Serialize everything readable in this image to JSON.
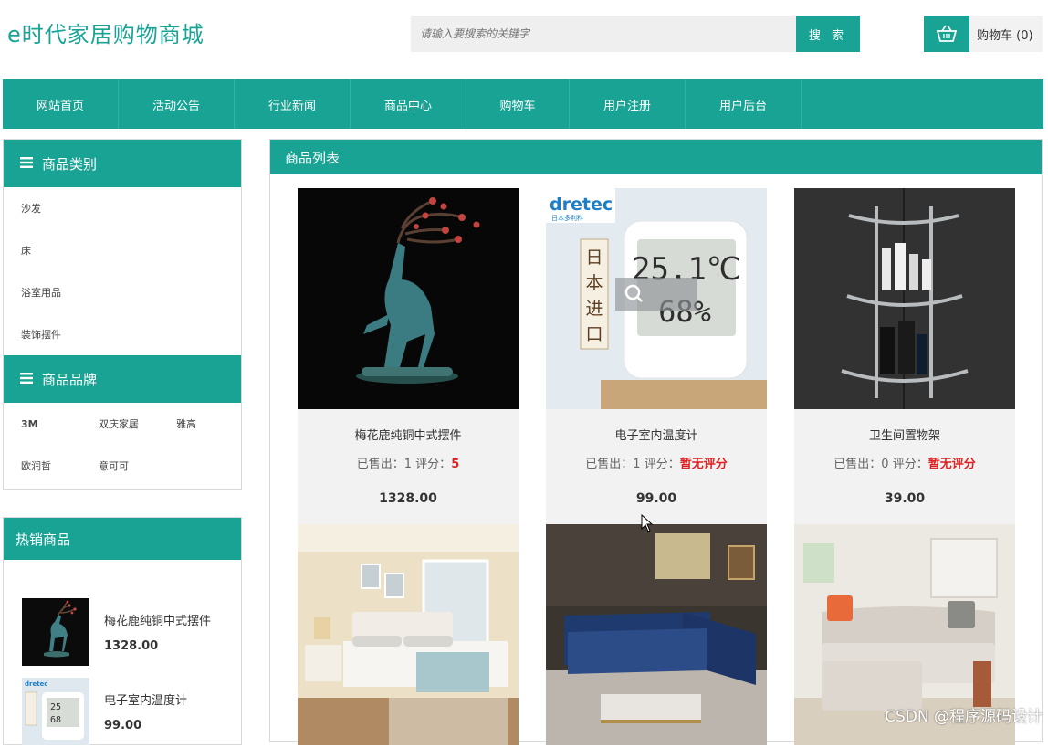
{
  "header": {
    "logo": "e时代家居购物商城",
    "search_placeholder": "请输入要搜索的关键字",
    "search_button": "搜 索",
    "cart_label": "购物车 (0)",
    "cart_icon": "basket-icon"
  },
  "nav": {
    "items": [
      "网站首页",
      "活动公告",
      "行业新闻",
      "商品中心",
      "购物车",
      "用户注册",
      "用户后台"
    ]
  },
  "sidebar": {
    "categories_title": "商品类别",
    "categories": [
      "沙发",
      "床",
      "浴室用品",
      "装饰摆件"
    ],
    "brands_title": "商品品牌",
    "brands": [
      "3M",
      "双庆家居",
      "雅高",
      "欧润哲",
      "意可可"
    ],
    "hot_title": "热销商品",
    "hot_items": [
      {
        "name": "梅花鹿纯铜中式摆件",
        "price": "1328.00"
      },
      {
        "name": "电子室内温度计",
        "price": "99.00"
      }
    ]
  },
  "main": {
    "title": "商品列表",
    "products": [
      {
        "name": "梅花鹿纯铜中式摆件",
        "sold_label": "已售出：1",
        "rating_label": "评分：",
        "rating": "5",
        "price": "1328.00"
      },
      {
        "name": "电子室内温度计",
        "sold_label": "已售出：1",
        "rating_label": "评分：",
        "rating": "暂无评分",
        "price": "99.00"
      },
      {
        "name": "卫生间置物架",
        "sold_label": "已售出：0",
        "rating_label": "评分：",
        "rating": "暂无评分",
        "price": "39.00"
      }
    ],
    "thermometer_brand": "dretec",
    "thermometer_brand_sub": "日本多利科",
    "thermometer_banner": "日本进口",
    "thermometer_temp": "25.1℃",
    "thermometer_humidity": "68%"
  },
  "watermark": "CSDN @程序源码设计",
  "colors": {
    "accent": "#19a394",
    "rating": "#e02020"
  }
}
